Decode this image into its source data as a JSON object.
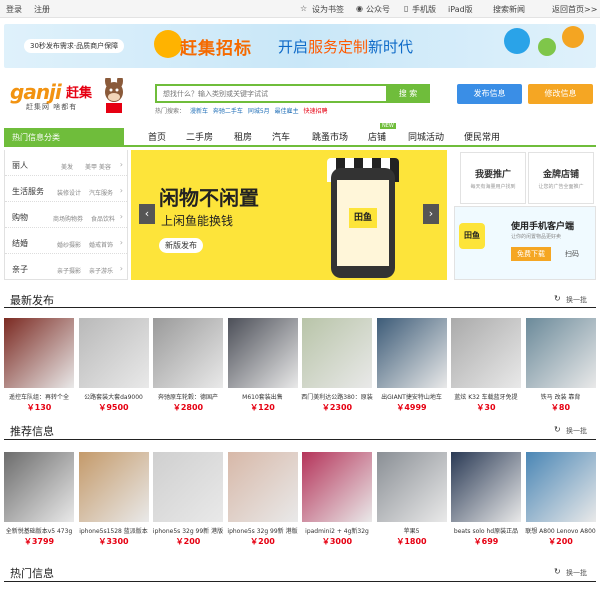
{
  "topbar": {
    "login": "登录",
    "register": "注册",
    "bookmark": "设为书签",
    "wechat": "公众号",
    "mobile": "手机版",
    "ipad": "iPad版",
    "search_news": "搜索新闻",
    "home": "返回首页>>"
  },
  "banner": {
    "small_text": "30秒发布需求·品质商户保障",
    "big_text": "赶集招标",
    "main_text_a": "开启",
    "main_text_b": "服务定制",
    "main_text_c": "新时代"
  },
  "logo": {
    "en": "ganji",
    "cn": "赶集",
    "slogan": "赶集网 啥都有"
  },
  "search": {
    "placeholder": "想找什么？输入类别或关键字试试",
    "button": "搜 索",
    "hot_label": "热门搜索：",
    "hot_items": [
      "漫新车",
      "奔驰二手车",
      "同城5月",
      "最佳雇主",
      "快速招聘"
    ]
  },
  "buttons": {
    "publish": "发布信息",
    "edit": "修改信息"
  },
  "categories_title": "热门信息分类",
  "nav": [
    "首页",
    "二手房",
    "租房",
    "汽车",
    "跳蚤市场",
    "店铺",
    "同城活动",
    "便民常用"
  ],
  "nav_new_tag": "NEW",
  "cats": [
    {
      "name": "丽人",
      "s1": "美发",
      "s2": "美甲 美容"
    },
    {
      "name": "生活服务",
      "s1": "装修设计",
      "s2": "汽车服务"
    },
    {
      "name": "购物",
      "s1": "商场购物券",
      "s2": "食品饮料"
    },
    {
      "name": "结婚",
      "s1": "婚纱摄影",
      "s2": "婚戒首饰"
    },
    {
      "name": "亲子",
      "s1": "亲子摄影",
      "s2": "亲子游乐"
    }
  ],
  "slider": {
    "title": "闲物不闲置",
    "subtitle": "上闲鱼能换钱",
    "badge": "新版发布",
    "app_name": "田鱼"
  },
  "promo": {
    "b1_title": "我要推广",
    "b1_desc": "每天有海量用户找到",
    "b2_title": "金牌店铺",
    "b2_desc": "让您的广告全面推广",
    "app_title": "使用手机客户端",
    "app_desc": "让你的闲置物品更好卖",
    "app_download": "免费下载",
    "app_scan": "扫码"
  },
  "latest": {
    "title": "最新发布",
    "change": "换一批",
    "items": [
      {
        "name": "遥控车队组：再转个全",
        "price": "￥130",
        "color": "#7b2a22"
      },
      {
        "name": "公路套装大套da9000",
        "price": "￥9500",
        "color": "#b9b9b9"
      },
      {
        "name": "奔驰原车轮毂：德国产",
        "price": "￥2800",
        "color": "#9a9a9a"
      },
      {
        "name": "M610套装出售",
        "price": "￥120",
        "color": "#4c4f58"
      },
      {
        "name": "西门美利达公路380：原装",
        "price": "￥2300",
        "color": "#b8c4a8"
      },
      {
        "name": "出GIANT捷安特山地车",
        "price": "￥4999",
        "color": "#3d5c78"
      },
      {
        "name": "蓝炫 K32 车载蓝牙免提",
        "price": "￥30",
        "color": "#aaaaaa"
      },
      {
        "name": "铁马 改装 靠背",
        "price": "￥80",
        "color": "#6b8a9a"
      }
    ]
  },
  "recommend": {
    "title": "推荐信息",
    "change": "换一批",
    "items": [
      {
        "name": "全新悦基础版本v5 473g",
        "price": "￥3799",
        "color": "#6c6c6c"
      },
      {
        "name": "iphone5s1528 蓝派版本",
        "price": "￥3300",
        "color": "#c49a6a"
      },
      {
        "name": "iphone5s 32g 99新 港版",
        "price": "￥200",
        "color": "#cfcfcf"
      },
      {
        "name": "iphone5s 32g 99新 港版",
        "price": "￥200",
        "color": "#d7b8a8"
      },
      {
        "name": "ipadmini2 + 4g新32g",
        "price": "￥3000",
        "color": "#b5345a"
      },
      {
        "name": "苹果5",
        "price": "￥1800",
        "color": "#8a8f95"
      },
      {
        "name": "beats solo hd原装正品",
        "price": "￥699",
        "color": "#2a3a55"
      },
      {
        "name": "联想 A800 Lenovo A800",
        "price": "￥200",
        "color": "#4a86b5"
      }
    ]
  },
  "hotinfo": {
    "title": "热门信息",
    "change": "换一批"
  },
  "colors": {
    "accent": "#6fbd3b",
    "price": "#e60012",
    "publish": "#3a8ee6",
    "edit": "#f5a623"
  }
}
